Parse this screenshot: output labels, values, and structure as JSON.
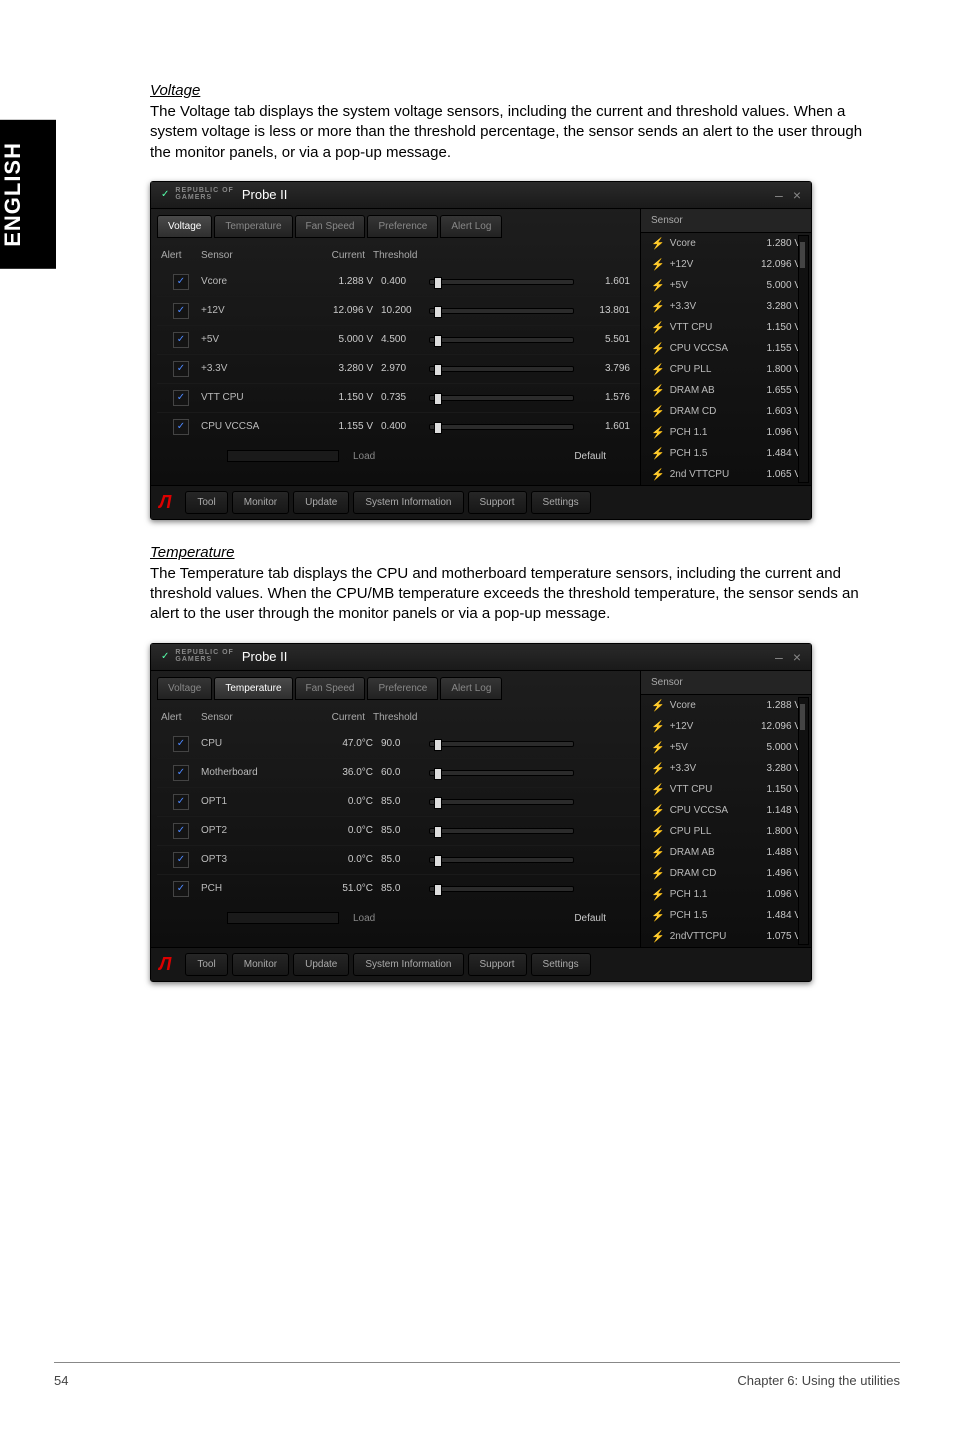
{
  "page": {
    "lang_tab": "ENGLISH",
    "footer_page": "54",
    "footer_chapter": "Chapter 6: Using the utilities"
  },
  "voltage_section": {
    "title": "Voltage",
    "body": "The Voltage tab displays the system voltage sensors, including the current and threshold values. When a system voltage is less or more than the threshold percentage, the sensor sends an alert to the user through the monitor panels, or via a pop-up message."
  },
  "temperature_section": {
    "title": "Temperature",
    "body": "The Temperature tab displays the CPU and motherboard temperature sensors, including the current and threshold values. When the CPU/MB temperature exceeds the threshold temperature, the sensor sends an alert to the user through the monitor panels or via a pop-up message."
  },
  "probe_common": {
    "brand_top": "REPUBLIC OF",
    "brand_bottom": "GAMERS",
    "app_title": "Probe II",
    "win_min": "–",
    "win_close": "×",
    "tabs": [
      "Voltage",
      "Temperature",
      "Fan Speed",
      "Preference",
      "Alert Log"
    ],
    "col_alert": "Alert",
    "col_sensor": "Sensor",
    "col_current": "Current",
    "col_threshold": "Threshold",
    "load_label": "Load",
    "default_btn": "Default",
    "right_header": "Sensor",
    "footer_buttons": [
      "Tool",
      "Monitor",
      "Update",
      "System Information",
      "Support",
      "Settings"
    ]
  },
  "voltage_probe": {
    "active_tab": 0,
    "rows": [
      {
        "sensor": "Vcore",
        "current": "1.288 V",
        "threshold": "0.400",
        "upper": "1.601"
      },
      {
        "sensor": "+12V",
        "current": "12.096 V",
        "threshold": "10.200",
        "upper": "13.801"
      },
      {
        "sensor": "+5V",
        "current": "5.000 V",
        "threshold": "4.500",
        "upper": "5.501"
      },
      {
        "sensor": "+3.3V",
        "current": "3.280 V",
        "threshold": "2.970",
        "upper": "3.796"
      },
      {
        "sensor": "VTT CPU",
        "current": "1.150 V",
        "threshold": "0.735",
        "upper": "1.576"
      },
      {
        "sensor": "CPU VCCSA",
        "current": "1.155 V",
        "threshold": "0.400",
        "upper": "1.601"
      }
    ],
    "right": [
      {
        "n": "Vcore",
        "v": "1.280 V"
      },
      {
        "n": "+12V",
        "v": "12.096 V"
      },
      {
        "n": "+5V",
        "v": "5.000 V"
      },
      {
        "n": "+3.3V",
        "v": "3.280 V"
      },
      {
        "n": "VTT CPU",
        "v": "1.150 V"
      },
      {
        "n": "CPU VCCSA",
        "v": "1.155 V"
      },
      {
        "n": "CPU PLL",
        "v": "1.800 V"
      },
      {
        "n": "DRAM AB",
        "v": "1.655 V"
      },
      {
        "n": "DRAM CD",
        "v": "1.603 V"
      },
      {
        "n": "PCH 1.1",
        "v": "1.096 V"
      },
      {
        "n": "PCH 1.5",
        "v": "1.484 V"
      },
      {
        "n": "2nd VTTCPU",
        "v": "1.065 V"
      }
    ]
  },
  "temperature_probe": {
    "active_tab": 1,
    "rows": [
      {
        "sensor": "CPU",
        "current": "47.0°C",
        "threshold": "90.0",
        "upper": ""
      },
      {
        "sensor": "Motherboard",
        "current": "36.0°C",
        "threshold": "60.0",
        "upper": ""
      },
      {
        "sensor": "OPT1",
        "current": "0.0°C",
        "threshold": "85.0",
        "upper": ""
      },
      {
        "sensor": "OPT2",
        "current": "0.0°C",
        "threshold": "85.0",
        "upper": ""
      },
      {
        "sensor": "OPT3",
        "current": "0.0°C",
        "threshold": "85.0",
        "upper": ""
      },
      {
        "sensor": "PCH",
        "current": "51.0°C",
        "threshold": "85.0",
        "upper": ""
      }
    ],
    "right": [
      {
        "n": "Vcore",
        "v": "1.288 V"
      },
      {
        "n": "+12V",
        "v": "12.096 V"
      },
      {
        "n": "+5V",
        "v": "5.000 V"
      },
      {
        "n": "+3.3V",
        "v": "3.280 V"
      },
      {
        "n": "VTT CPU",
        "v": "1.150 V"
      },
      {
        "n": "CPU VCCSA",
        "v": "1.148 V"
      },
      {
        "n": "CPU PLL",
        "v": "1.800 V"
      },
      {
        "n": "DRAM AB",
        "v": "1.488 V"
      },
      {
        "n": "DRAM CD",
        "v": "1.496 V"
      },
      {
        "n": "PCH 1.1",
        "v": "1.096 V"
      },
      {
        "n": "PCH 1.5",
        "v": "1.484 V"
      },
      {
        "n": "2ndVTTCPU",
        "v": "1.075 V"
      }
    ]
  }
}
